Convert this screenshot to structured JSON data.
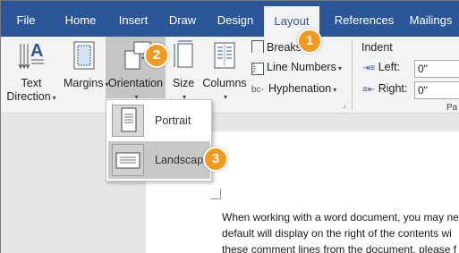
{
  "tabs": [
    "File",
    "Home",
    "Insert",
    "Draw",
    "Design",
    "Layout",
    "References",
    "Mailings"
  ],
  "active_tab": "Layout",
  "ribbon": {
    "text_direction": {
      "line1": "Text",
      "line2": "Direction"
    },
    "margins": "Margins",
    "orientation": "Orientation",
    "size": "Size",
    "columns": "Columns",
    "breaks": "Breaks",
    "line_numbers": "Line Numbers",
    "hyphenation": "Hyphenation",
    "indent_title": "Indent",
    "indent_left_label": "Left:",
    "indent_left_value": "0\"",
    "indent_right_label": "Right:",
    "indent_right_value": "0\"",
    "truncated_group": "Pa"
  },
  "orientation_menu": {
    "portrait": "Portrait",
    "landscape": "Landscape",
    "selected": "Landscape"
  },
  "callouts": [
    "1",
    "2",
    "3"
  ],
  "document": {
    "lines": [
      "When working with a word document, you may ne",
      "default will display on the right of the contents wi",
      "these comment lines from the document, please f"
    ]
  },
  "colors": {
    "ribbon_blue": "#2b579a",
    "callout_orange": "#f39a1d",
    "pressed_gray": "#c5c5c5"
  }
}
